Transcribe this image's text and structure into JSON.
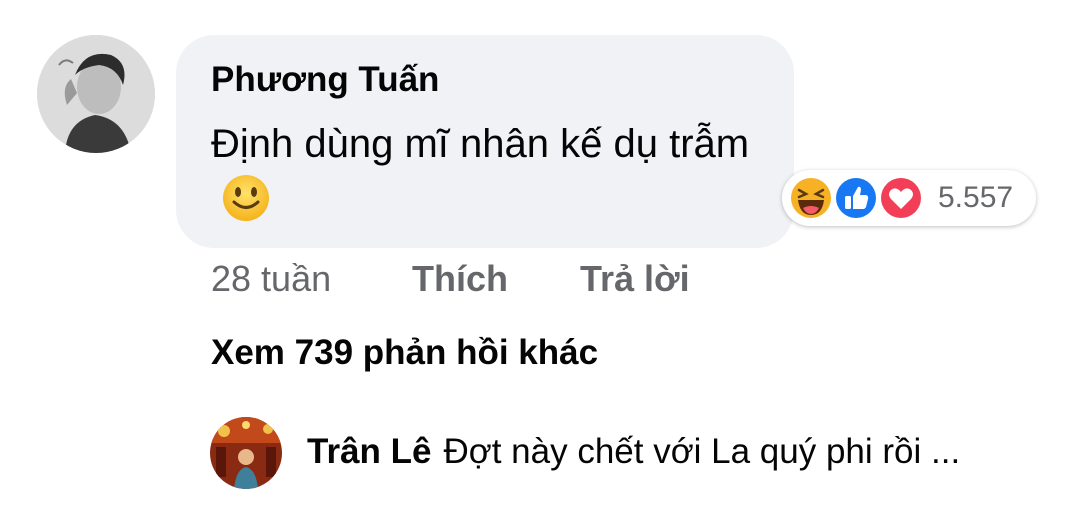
{
  "comment": {
    "author": "Phương Tuấn",
    "text": "Định dùng mĩ nhân kế dụ trẫm",
    "emoji": "slightly-smiling-face",
    "reactions": {
      "icons": [
        "haha-icon",
        "like-icon",
        "love-icon"
      ],
      "count": "5.557"
    },
    "time": "28 tuần",
    "like_label": "Thích",
    "reply_label": "Trả lời"
  },
  "more_replies_label": "Xem 739 phản hồi khác",
  "latest_reply": {
    "author": "Trân Lê",
    "text": "Đợt này chết với La quý phi rồi ..."
  },
  "colors": {
    "bubble": "#f0f2f5",
    "text": "#050505",
    "secondary": "#65676b",
    "like_blue": "#1877f2",
    "love_red": "#f33e58",
    "haha_yellow": "#f7b125"
  }
}
